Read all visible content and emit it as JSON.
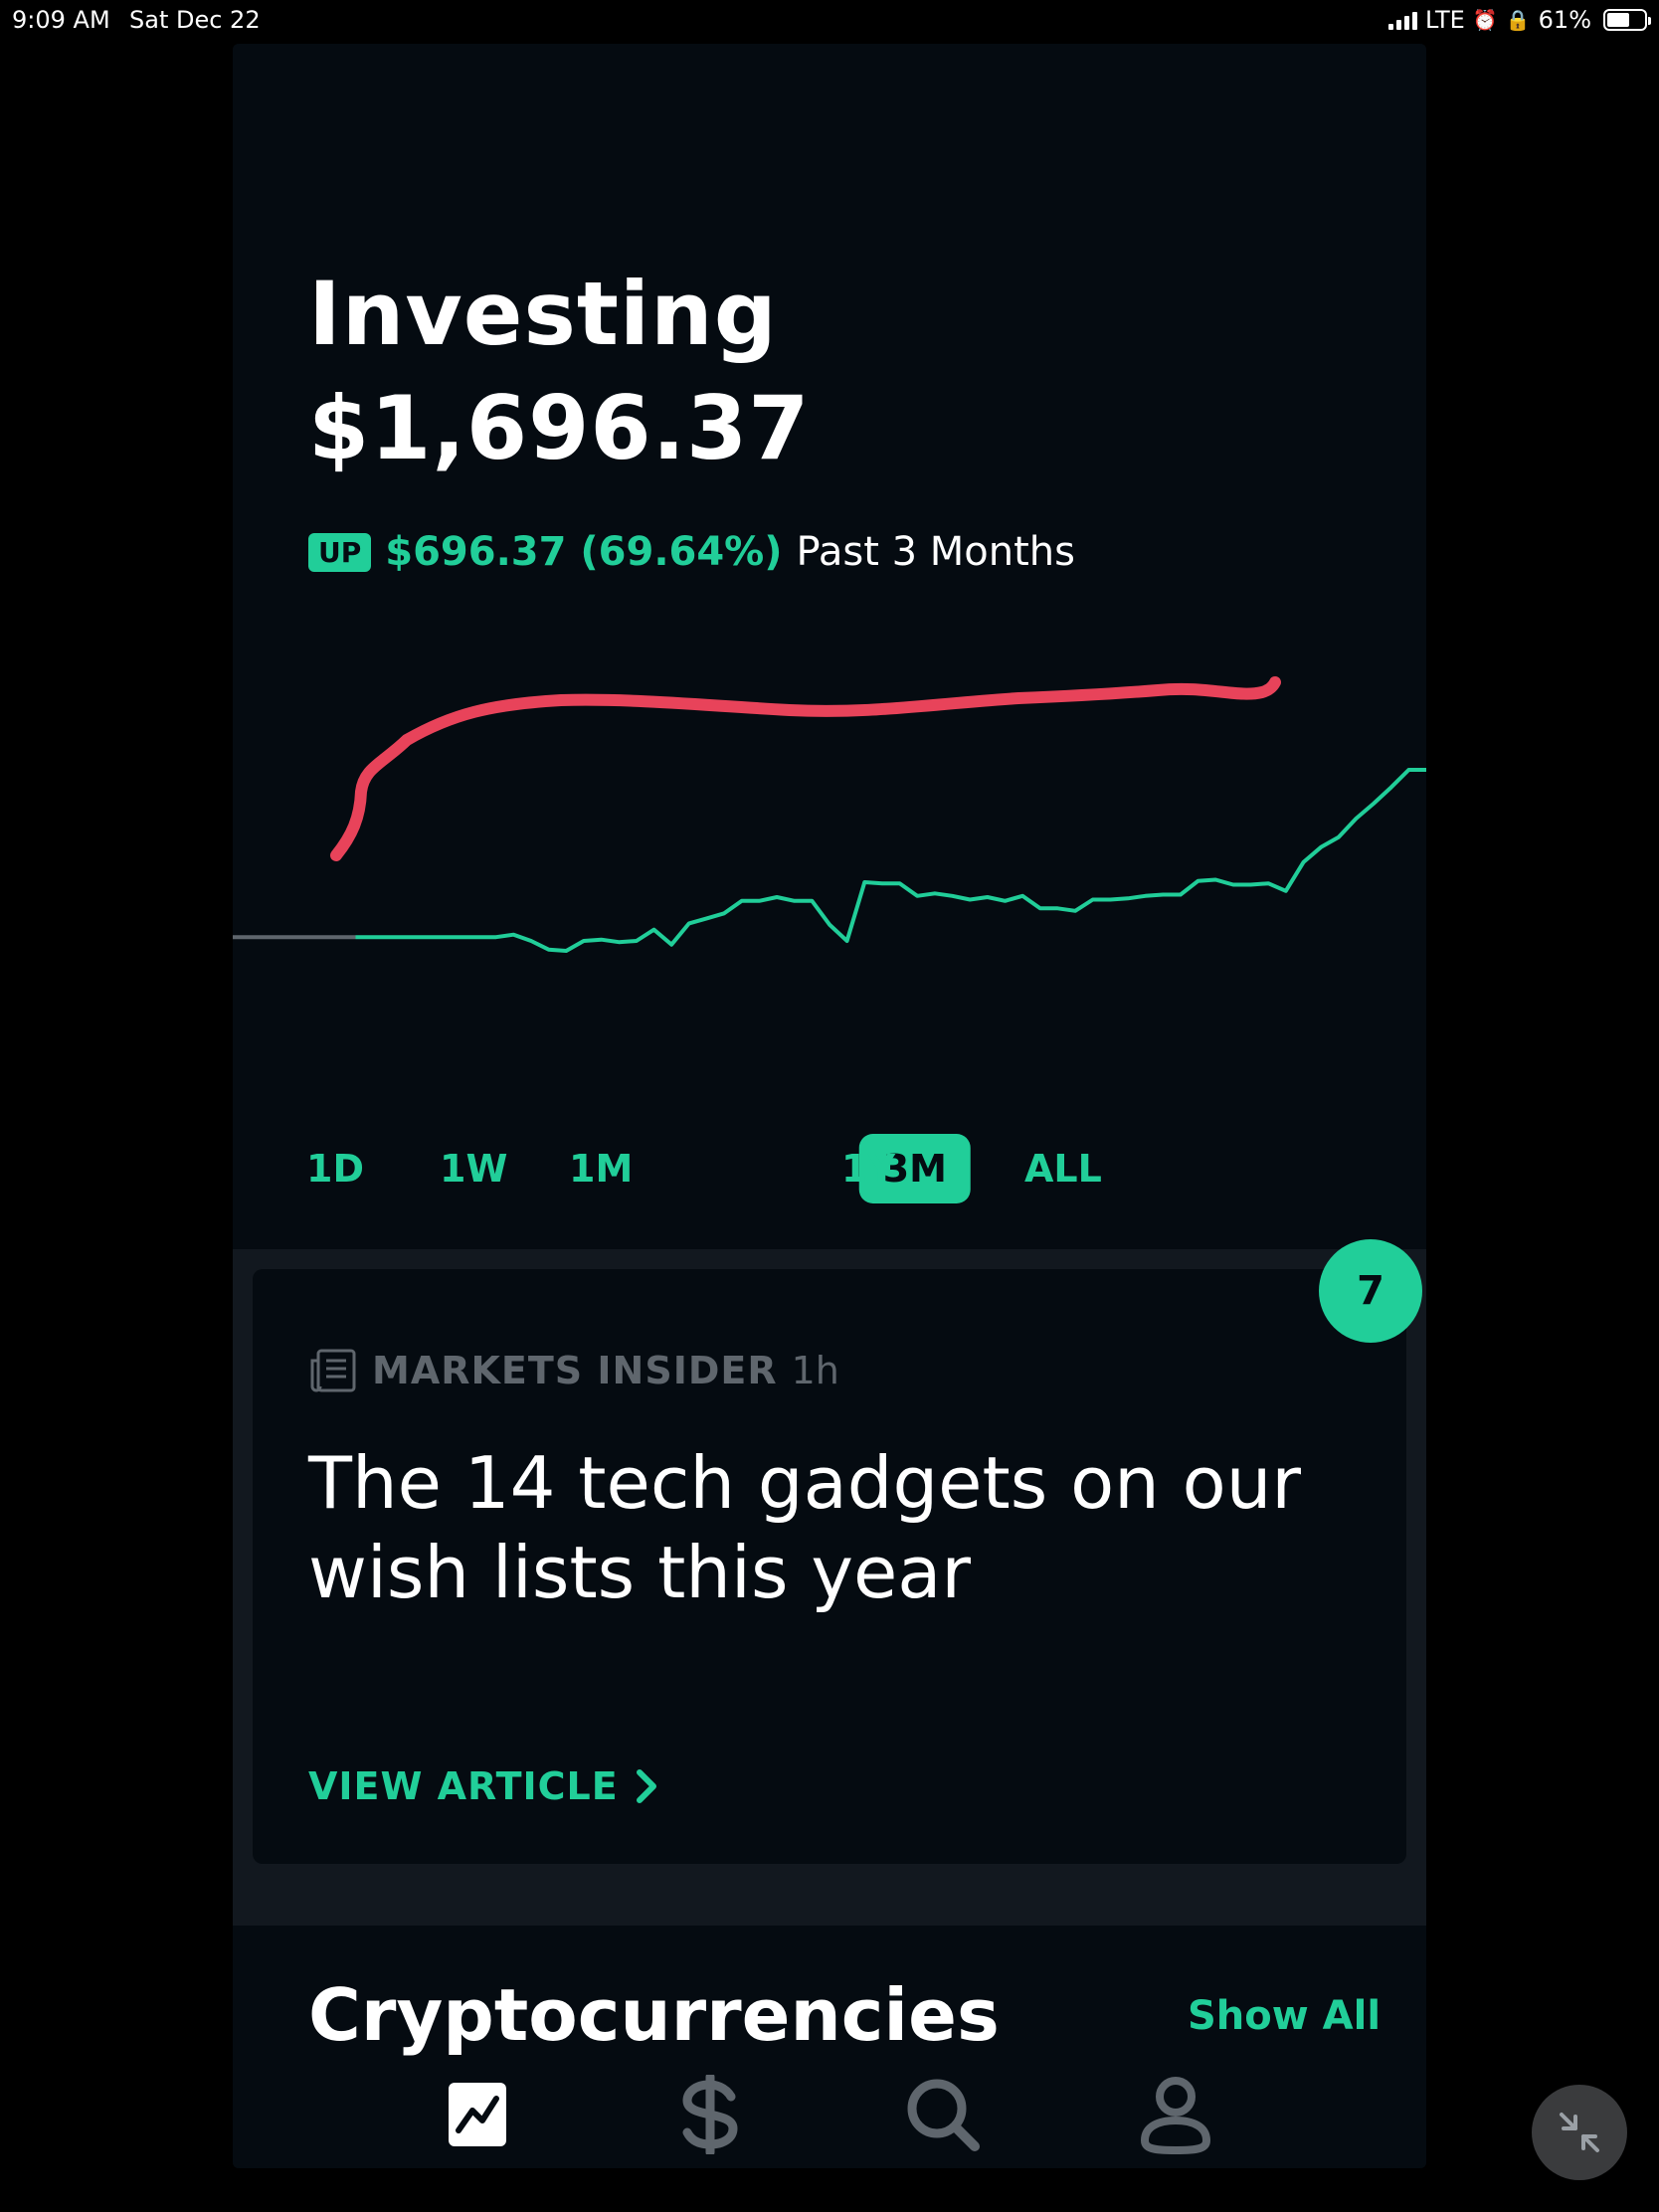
{
  "status_bar": {
    "time": "9:09 AM",
    "date": "Sat Dec 22",
    "network": "LTE",
    "battery": "61%",
    "battery_level": 0.61
  },
  "portfolio": {
    "title": "Investing",
    "value": "$1,696.37",
    "badge": "UP",
    "change": "$696.37 (69.64%)",
    "period": "Past 3 Months"
  },
  "colors": {
    "accent": "#21ce99",
    "background": "#050b11",
    "annotation": "#e8435a",
    "muted": "#5f666d"
  },
  "chart_data": {
    "type": "line",
    "series": [
      {
        "values": [
          0,
          0,
          0,
          0,
          0,
          0,
          0,
          0,
          0,
          0,
          0,
          0,
          0,
          0,
          0,
          0,
          2,
          -3,
          -10,
          -11,
          -3,
          -2,
          -4,
          -3,
          6,
          -6,
          11,
          15,
          19,
          29,
          29,
          32,
          29,
          29,
          10,
          -3,
          44,
          43,
          43,
          33,
          35,
          33,
          30,
          32,
          29,
          33,
          23,
          23,
          21,
          30,
          30,
          31,
          33,
          34,
          34,
          45,
          46,
          42,
          42,
          43,
          37,
          60,
          72,
          80,
          95,
          107,
          120,
          134,
          134
        ]
      }
    ],
    "xlabel": "",
    "ylabel": "",
    "grid": false,
    "baseline_segment": "gray flat line at start of period"
  },
  "ranges": [
    "1D",
    "1W",
    "1M",
    "3M",
    "1Y",
    "ALL"
  ],
  "active_range": "3M",
  "news": {
    "source": "MARKETS INSIDER",
    "age": "1h",
    "headline": "The 14 tech gadgets on our wish lists this year",
    "action": "VIEW ARTICLE",
    "count": "7"
  },
  "crypto": {
    "title": "Cryptocurrencies",
    "show_all": "Show All"
  },
  "tabs": [
    "chart-icon",
    "dollar-icon",
    "search-icon",
    "account-icon"
  ],
  "active_tab": "chart-icon"
}
